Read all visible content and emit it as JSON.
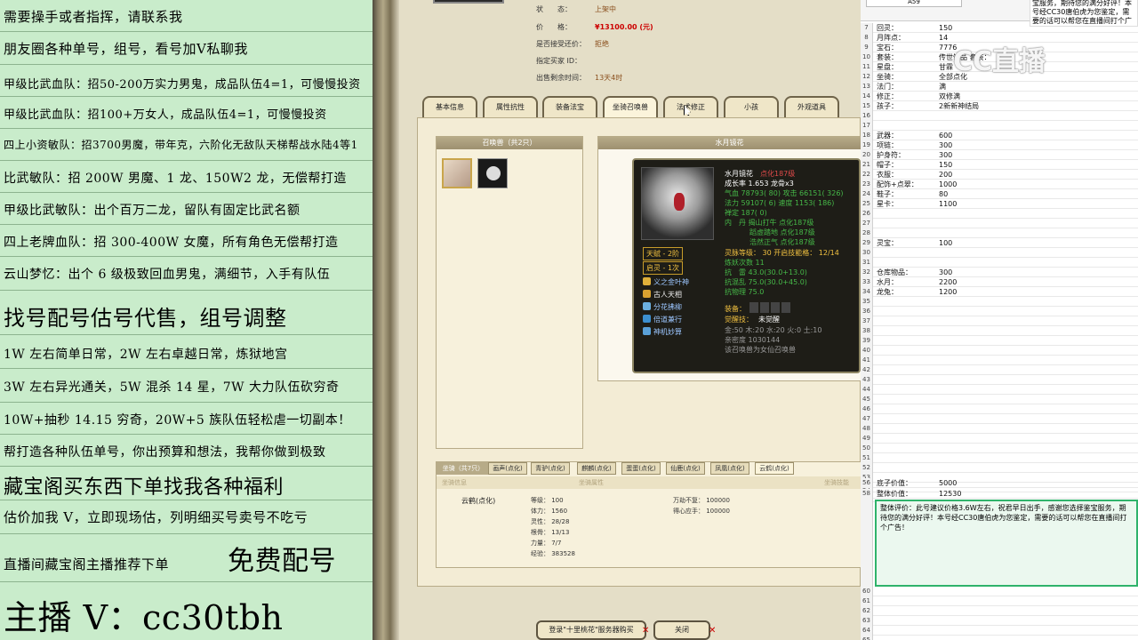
{
  "left_panel": {
    "lines": [
      "需要操手或者指挥，请联系我",
      "朋友圈各种单号，组号，看号加V私聊我",
      "甲级比武血队：招50-200万实力男鬼，成品队伍4=1，可慢慢投资",
      "甲级比武血队：招100+万女人，成品队伍4=1，可慢慢投资",
      "四上小资敏队：招3700男魔，带年克，六阶化无敌队天梯帮战水陆4等1",
      "比武敏队：招 200W 男魔、1 龙、150W2 龙，无偿帮打造",
      "甲级比武敏队：出个百万二龙，留队有固定比武名额",
      "四上老牌血队：招 300-400W 女魔，所有角色无偿帮打造",
      "云山梦忆：出个 6 级极致回血男鬼，满细节，入手有队伍",
      "找号配号估号代售，组号调整",
      "1W 左右简单日常，2W 左右卓越日常，炼狱地宫",
      "3W 左右异光通关，5W 混杀 14 星，7W 大力队伍砍穷奇",
      "10W+抽秒 14.15 穷奇，20W+5 族队伍轻松虐一切副本！",
      "帮打造各种队伍单号，你出预算和想法，我帮你做到极致",
      "藏宝阁买东西下单找我各种福利",
      "估价加我 V，立即现场估，列明细买号卖号不吃亏",
      "直播间藏宝阁主播推荐下单",
      "免费配号",
      "主播 V：cc30tbh"
    ]
  },
  "game": {
    "status_label": "状　　态：",
    "status_value": "上架中",
    "price_label": "价　　格：",
    "price_value": "¥13100.00 (元)",
    "bargain_label": "是否接受还价：",
    "bargain_value": "拒绝",
    "buyer_label": "指定买家 ID：",
    "buyer_value": "",
    "remain_label": "出售剩余时间：",
    "remain_value": "13天4时",
    "tabs": [
      "基本信息",
      "属性抗性",
      "装备法宝",
      "坐骑召唤兽",
      "法术修正",
      "小孩",
      "外观道具"
    ],
    "active_tab": "坐骑召唤兽",
    "pet_list_title": "召唤兽（共2只）",
    "detail_title": "水月镜花",
    "tooltip": {
      "name": "水月镜花",
      "name_suffix": "点化187级",
      "growth": "成长率 1.653  龙骨x3",
      "hp": "气血 78793(  80) 攻击 66151(  326)",
      "mp": "法力 59107(   6) 速度 1153(  186)",
      "zen": "禅定 187(   0)",
      "elements": "内　丹 揭山打牛 点化187级",
      "inner2": "蹈虚踏地 点化187级",
      "inner3": "浩然正气 点化187级",
      "talent_badge": "天赋 - 2阶",
      "enlight_badge": "启灵 - 1次",
      "spirit_level": "灵脉等级：  30 开启技能格：  12/14",
      "refine": "炼妖次数 11",
      "res_thunder": "抗　雷 43.0(30.0+13.0)",
      "res_chaos": "抗混乱 75.0(30.0+45.0)",
      "res_phys": "抗物理 75.0",
      "skills": [
        "义之金叶神",
        "古人天相",
        "分花拂柳",
        "倍道兼行",
        "神机妙算"
      ],
      "equip_label": "装备：",
      "awaken_label": "觉醒技：",
      "awaken_value": "未觉醒",
      "stats_line": "金:50 木:20 水:20 火:0 土:10",
      "intimacy": "亲密度 1030144",
      "note": "该召唤兽为女仙召唤兽"
    },
    "mount_header": "坐骑（共7只）",
    "mount_tabs": [
      "画声(点化)",
      "青驴(点化)",
      "麒麟(点化)",
      "蛋蛋(点化)",
      "仙鹿(点化)",
      "凤凰(点化)",
      "云鹤(点化)"
    ],
    "mount_sub": [
      "坐骑信息",
      "坐骑属性",
      "坐骑技能"
    ],
    "mount": {
      "name": "云鹤(点化)",
      "level": "等级：  100",
      "stamina": "体力：  1560",
      "spirit": "灵性：  28/28",
      "root": "根骨：  13/13",
      "power": "力量：  7/7",
      "exp": "经验：  383528",
      "skill1": "万劫不复：  100000",
      "skill2": "得心应手：  100000"
    },
    "btn_login": "登录\"十里桃花\"服务器购买",
    "btn_close": "关闭"
  },
  "sheet": {
    "top_name_box": "A59",
    "watermark": "CC直播",
    "note_top": "宝服务，期待您的满分好评！本号经CC30唐伯虎为您鉴定，需要的话可以帮您在直播间打个广告",
    "rows": [
      {
        "n": "7",
        "k": "回灵：",
        "v": "150"
      },
      {
        "n": "8",
        "k": "月阵点：",
        "v": "14"
      },
      {
        "n": "9",
        "k": "宝石：",
        "v": "7776"
      },
      {
        "n": "10",
        "k": "套装：",
        "v": "传世饰品 套装："
      },
      {
        "n": "11",
        "k": "星盘：",
        "v": "甘霖"
      },
      {
        "n": "12",
        "k": "坐骑：",
        "v": "全部点化"
      },
      {
        "n": "13",
        "k": "法门：",
        "v": "满"
      },
      {
        "n": "14",
        "k": "修正：",
        "v": "双修满"
      },
      {
        "n": "15",
        "k": "孩子：",
        "v": "2新新神结局"
      },
      {
        "n": "16",
        "k": "",
        "v": ""
      },
      {
        "n": "17",
        "k": "",
        "v": ""
      },
      {
        "n": "18",
        "k": "武器：",
        "v": "600"
      },
      {
        "n": "19",
        "k": "项链：",
        "v": "300"
      },
      {
        "n": "20",
        "k": "护身符：",
        "v": "300"
      },
      {
        "n": "21",
        "k": "帽子：",
        "v": "150"
      },
      {
        "n": "22",
        "k": "衣服：",
        "v": "200"
      },
      {
        "n": "23",
        "k": "配饰+点翠：",
        "v": "1000"
      },
      {
        "n": "24",
        "k": "鞋子：",
        "v": "80"
      },
      {
        "n": "25",
        "k": "星卡：",
        "v": "1100"
      },
      {
        "n": "26",
        "k": "",
        "v": ""
      },
      {
        "n": "27",
        "k": "",
        "v": ""
      },
      {
        "n": "28",
        "k": "",
        "v": ""
      },
      {
        "n": "29",
        "k": "灵宝：",
        "v": "100"
      },
      {
        "n": "30",
        "k": "",
        "v": ""
      },
      {
        "n": "31",
        "k": "",
        "v": ""
      },
      {
        "n": "32",
        "k": "仓库物品：",
        "v": "300"
      },
      {
        "n": "33",
        "k": "水月：",
        "v": "2200"
      },
      {
        "n": "34",
        "k": "龙兔：",
        "v": "1200"
      },
      {
        "n": "35",
        "k": "",
        "v": ""
      },
      {
        "n": "36",
        "k": "",
        "v": ""
      },
      {
        "n": "37",
        "k": "",
        "v": ""
      },
      {
        "n": "38",
        "k": "",
        "v": ""
      },
      {
        "n": "39",
        "k": "",
        "v": ""
      },
      {
        "n": "40",
        "k": "",
        "v": ""
      },
      {
        "n": "41",
        "k": "",
        "v": ""
      },
      {
        "n": "42",
        "k": "",
        "v": ""
      },
      {
        "n": "43",
        "k": "",
        "v": ""
      },
      {
        "n": "44",
        "k": "",
        "v": ""
      },
      {
        "n": "45",
        "k": "",
        "v": ""
      },
      {
        "n": "46",
        "k": "",
        "v": ""
      },
      {
        "n": "47",
        "k": "",
        "v": ""
      },
      {
        "n": "48",
        "k": "",
        "v": ""
      },
      {
        "n": "49",
        "k": "",
        "v": ""
      },
      {
        "n": "50",
        "k": "",
        "v": ""
      },
      {
        "n": "51",
        "k": "",
        "v": ""
      },
      {
        "n": "52",
        "k": "",
        "v": ""
      },
      {
        "n": "53",
        "k": "",
        "v": ""
      },
      {
        "n": "54",
        "k": "",
        "v": ""
      },
      {
        "n": "55",
        "k": "",
        "v": ""
      },
      {
        "n": "56",
        "k": "底子价值：",
        "v": "5000"
      },
      {
        "n": "58",
        "k": "整体价值：",
        "v": "12530"
      }
    ],
    "comment": "整体评价：此号建议价格3.6W左右，祝君早日出手，感谢您选择鉴宝服务，期待您的满分好评！本号经CC30唐伯虎为您鉴定，需要的话可以帮您在直播间打个广告！",
    "bottom_rows": [
      "60",
      "61",
      "62",
      "63",
      "64",
      "65"
    ]
  }
}
